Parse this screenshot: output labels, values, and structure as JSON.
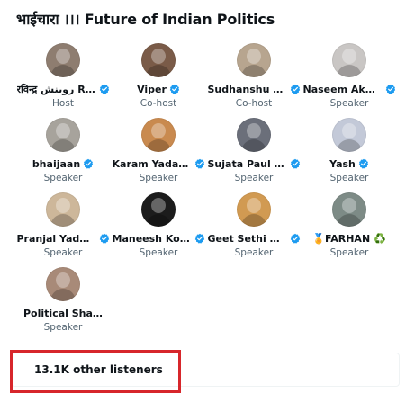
{
  "space": {
    "title": "भाईचारा ।।। Future of Indian Politics"
  },
  "speakers": [
    {
      "name": "रविन्द्र روینش Ra...",
      "role": "Host",
      "verified": true,
      "avatar_color": "#8e7d70"
    },
    {
      "name": "Viper",
      "role": "Co-host",
      "verified": true,
      "avatar_color": "#7a5b48"
    },
    {
      "name": "Sudhanshu Y...",
      "role": "Co-host",
      "verified": true,
      "avatar_color": "#b7a58f"
    },
    {
      "name": "Naseem Akht...",
      "role": "Speaker",
      "verified": true,
      "avatar_color": "#c9c6c4"
    },
    {
      "name": "bhaijaan",
      "role": "Speaker",
      "verified": true,
      "avatar_color": "#a7a39c"
    },
    {
      "name": "Karam Yadav ...",
      "role": "Speaker",
      "verified": true,
      "avatar_color": "#c98a4f"
    },
    {
      "name": "Sujata Paul - ...",
      "role": "Speaker",
      "verified": true,
      "avatar_color": "#6b6f7a"
    },
    {
      "name": "Yash",
      "role": "Speaker",
      "verified": true,
      "avatar_color": "#c3c9d8"
    },
    {
      "name": "Pranjal Yadava",
      "role": "Speaker",
      "verified": true,
      "avatar_color": "#cdb79a"
    },
    {
      "name": "Maneesh Kot...",
      "role": "Speaker",
      "verified": true,
      "avatar_color": "#1c1c1c"
    },
    {
      "name": "Geet Sethi Advo...",
      "role": "Speaker",
      "verified": true,
      "avatar_color": "#d19a52"
    },
    {
      "name": "🏅FARHAN ♻️",
      "role": "Speaker",
      "verified": false,
      "avatar_color": "#7d8b86"
    },
    {
      "name": "Political SharmaJi",
      "role": "Speaker",
      "verified": false,
      "avatar_color": "#a88a78"
    }
  ],
  "listeners": {
    "label": "13.1K other listeners"
  },
  "colors": {
    "verified_badge": "#1d9bf0",
    "highlight_box": "#d7262b",
    "role_text": "#536471"
  }
}
